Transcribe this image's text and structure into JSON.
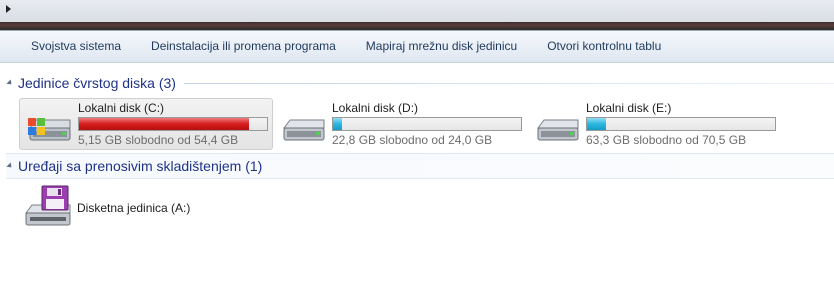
{
  "toolbar": {
    "items": [
      "Svojstva sistema",
      "Deinstalacija ili promena programa",
      "Mapiraj mrežnu disk jedinicu",
      "Otvori kontrolnu tablu"
    ]
  },
  "groups": {
    "hard_disks": {
      "title": "Jedinice čvrstog diska (3)",
      "drives": [
        {
          "name": "Lokalni disk (C:)",
          "info": "5,15 GB slobodno od 54,4 GB",
          "used_fraction": 0.905,
          "bar_color": "#d61d1d",
          "selected": true,
          "icon": "system-drive-icon"
        },
        {
          "name": "Lokalni disk (D:)",
          "info": "22,8 GB slobodno od 24,0 GB",
          "used_fraction": 0.05,
          "bar_color": "#2cb6e0",
          "selected": false,
          "icon": "hard-drive-icon"
        },
        {
          "name": "Lokalni disk (E:)",
          "info": "63,3 GB slobodno od 70,5 GB",
          "used_fraction": 0.1,
          "bar_color": "#2cb6e0",
          "selected": false,
          "icon": "hard-drive-icon"
        }
      ]
    },
    "removable": {
      "title": "Uređaji sa prenosivim skladištenjem (1)",
      "devices": [
        {
          "name": "Disketna jedinica (A:)",
          "icon": "floppy-drive-icon"
        }
      ]
    }
  }
}
